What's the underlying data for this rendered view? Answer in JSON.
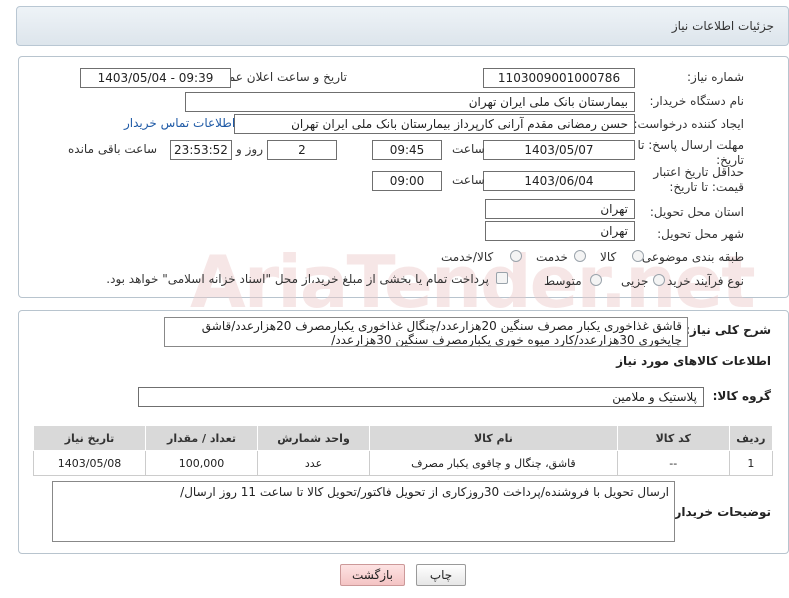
{
  "header": {
    "title": "جزئیات اطلاعات نیاز"
  },
  "form": {
    "need_number_label": "شماره نیاز:",
    "need_number": "1103009001000786",
    "announce_label": "تاریخ و ساعت اعلان عمومی:",
    "announce_value": "1403/05/04 - 09:39",
    "buyer_org_label": "نام دستگاه خریدار:",
    "buyer_org": "بیمارستان بانک ملی ایران تهران",
    "creator_label": "ایجاد کننده درخواست:",
    "creator": "حسن رمضانی مقدم آرانی کارپرداز بیمارستان بانک ملی ایران تهران",
    "contact_link": "اطلاعات تماس خریدار",
    "deadline_label": "مهلت ارسال پاسخ: تا تاریخ:",
    "deadline_date": "1403/05/07",
    "time_label": "ساعت",
    "deadline_time": "09:45",
    "days_value": "2",
    "days_label": "روز و",
    "remaining_time": "23:53:52",
    "remaining_label": "ساعت باقی مانده",
    "validity_label": "حداقل تاریخ اعتبار قیمت: تا تاریخ:",
    "validity_date": "1403/06/04",
    "validity_time": "09:00",
    "province_label": "استان محل تحویل:",
    "province": "تهران",
    "city_label": "شهر محل تحویل:",
    "city": "تهران",
    "category_label": "طبقه بندی موضوعی:",
    "category_options": [
      "کالا",
      "خدمت",
      "کالا/خدمت"
    ],
    "process_label": "نوع فرآیند خرید :",
    "process_options": [
      "جزیی",
      "متوسط"
    ],
    "payment_note": "پرداخت تمام یا بخشی از مبلغ خرید،از محل \"اسناد خزانه اسلامی\" خواهد بود."
  },
  "details": {
    "description_label": "شرح کلی نیاز:",
    "description": "قاشق غذاخوری یکبار مصرف سنگین 20هزارعدد/چنگال غذاخوری یکبارمصرف 20هزارعدد/قاشق چایخوری 30هزارعدد/کارد میوه خوری یکبارمصرف سنگین 30هزارعدد/",
    "goods_info_title": "اطلاعات کالاهای مورد نیاز",
    "goods_group_label": "گروه کالا:",
    "goods_group": "پلاستیک و ملامین",
    "table": {
      "headers": [
        "ردیف",
        "کد کالا",
        "نام کالا",
        "واحد شمارش",
        "تعداد / مقدار",
        "تاریخ نیاز"
      ],
      "rows": [
        [
          "1",
          "--",
          "قاشق، چنگال و چاقوی یکبار مصرف",
          "عدد",
          "100,000",
          "1403/05/08"
        ]
      ]
    },
    "buyer_notes_label": "توضیحات خریدار:",
    "buyer_notes": "ارسال تحویل با فروشنده/پرداخت 30روزکاری از تحویل فاکتور/تحویل کالا تا ساعت 11 روز ارسال/"
  },
  "buttons": {
    "print": "چاپ",
    "back": "بازگشت"
  },
  "watermark": "AriaTender.net"
}
